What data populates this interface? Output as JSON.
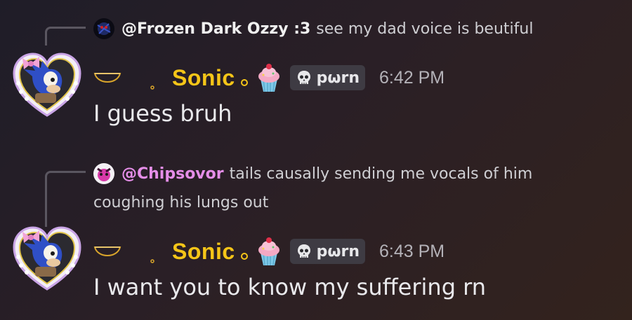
{
  "messages": [
    {
      "reply": {
        "author": "@Frozen Dark Ozzy :3",
        "author_color": "#f0f0f0",
        "text": "see my dad voice is beutiful"
      },
      "author": "Sonic",
      "tag": "pωrn",
      "timestamp": "6:42 PM",
      "content": "I guess bruh"
    },
    {
      "reply": {
        "author": "@Chipsovor",
        "author_color": "#e58ee8",
        "text_line1": "tails causally sending me vocals of him",
        "text_line2": "coughing his lungs out"
      },
      "author": "Sonic",
      "tag": "pωrn",
      "timestamp": "6:43 PM",
      "content": "I want you to know my suffering rn"
    }
  ],
  "colors": {
    "username": "#f5c518",
    "background_start": "#1f1d28",
    "background_end": "#33231d"
  }
}
